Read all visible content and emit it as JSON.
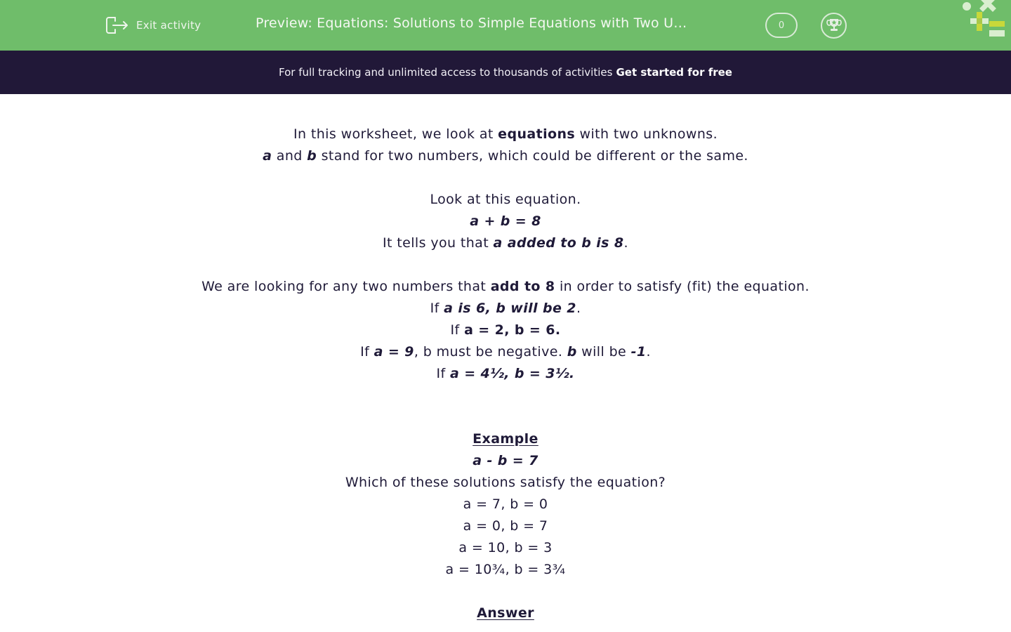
{
  "header": {
    "exit_label": "Exit activity",
    "title": "Preview: Equations: Solutions to Simple Equations with Two Unknowns",
    "score": "0",
    "icons": {
      "exit": "exit-icon",
      "trophy": "trophy-icon",
      "logo": "math-symbols-logo"
    },
    "colors": {
      "bar": "#6fbd6a",
      "logo_yellow": "#c8d83a",
      "logo_light": "#d9eecf"
    }
  },
  "banner": {
    "text": "For full tracking and unlimited access to thousands of activities",
    "cta": "Get started for free",
    "color": "#211838"
  },
  "content": {
    "intro": {
      "l1_a": "In this worksheet, we look at ",
      "l1_b": "equations",
      "l1_c": " with two unknowns.",
      "l2_a": "a",
      "l2_b": " and ",
      "l2_c": "b",
      "l2_d": " stand for two numbers, which could be different or the same."
    },
    "look": {
      "l1": "Look at this equation.",
      "equation": "a + b = 8",
      "l3_a": "It tells you that ",
      "l3_b": "a added to b is 8",
      "l3_c": "."
    },
    "search": {
      "l1_a": "We are looking for any two numbers that ",
      "l1_b": "add to 8",
      "l1_c": " in order to satisfy (fit) the equation.",
      "l2_a": "If ",
      "l2_b": "a is 6, b will be 2",
      "l2_c": ".",
      "l3_a": "If ",
      "l3_b": "a = 2, b = 6.",
      "l4_a": "If ",
      "l4_b": "a = 9",
      "l4_c": ", b must be negative. ",
      "l4_d": "b",
      "l4_e": " will be ",
      "l4_f": "-1",
      "l4_g": ".",
      "l5_a": "If ",
      "l5_b": "a = 4½, b = 3½."
    },
    "example": {
      "heading": "Example",
      "equation": "a - b = 7",
      "question": "Which of these solutions satisfy the equation?",
      "options": [
        "a = 7, b = 0",
        "a = 0, b = 7",
        "a = 10, b = 3",
        "a = 10¾, b = 3¾"
      ]
    },
    "answer": {
      "heading": "Answer"
    }
  }
}
